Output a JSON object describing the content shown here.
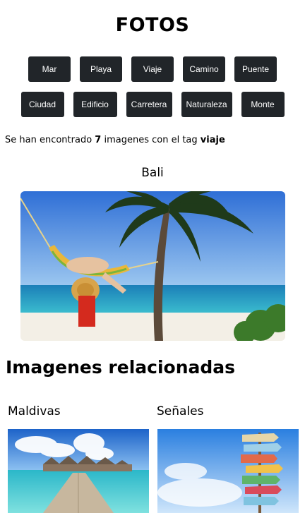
{
  "page": {
    "title": "FOTOS"
  },
  "tags": {
    "row1": [
      "Mar",
      "Playa",
      "Viaje",
      "Camino",
      "Puente"
    ],
    "row2": [
      "Ciudad",
      "Edificio",
      "Carretera",
      "Naturaleza",
      "Monte"
    ]
  },
  "result": {
    "prefix": "Se han encontrado",
    "count": "7",
    "middle": "imagenes con el tag",
    "tag": "viaje"
  },
  "main_photo": {
    "caption": "Bali"
  },
  "related": {
    "title": "Imagenes relacionadas",
    "items": [
      {
        "caption": "Maldivas"
      },
      {
        "caption": "Señales"
      }
    ]
  }
}
